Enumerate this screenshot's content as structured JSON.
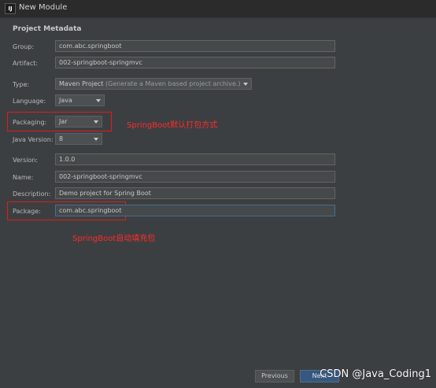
{
  "window": {
    "title": "New Module",
    "icon": "intellij-icon"
  },
  "section_title": "Project Metadata",
  "fields": {
    "group": {
      "label": "Group:",
      "value": "com.abc.springboot"
    },
    "artifact": {
      "label": "Artifact:",
      "value": "002-springboot-springmvc"
    },
    "type": {
      "label": "Type:",
      "value": "Maven Project",
      "hint": "(Generate a Maven based project archive.)"
    },
    "language": {
      "label": "Language:",
      "value": "Java"
    },
    "packaging": {
      "label": "Packaging:",
      "value": "Jar"
    },
    "java_version": {
      "label": "Java Version:",
      "value": "8"
    },
    "version": {
      "label": "Version:",
      "value": "1.0.0"
    },
    "name": {
      "label": "Name:",
      "value": "002-springboot-springmvc"
    },
    "description": {
      "label": "Description:",
      "value": "Demo project for Spring Boot"
    },
    "package": {
      "label": "Package:",
      "value": "com.abc.springboot"
    }
  },
  "annotations": {
    "packaging_note": "SpringBoot默认打包方式",
    "package_note": "SpringBoot自动填充包"
  },
  "buttons": {
    "previous": "Previous",
    "next": "Next"
  },
  "watermark": "CSDN @Java_Coding1",
  "colors": {
    "annotation_red": "#e21b1b",
    "primary_button": "#365880",
    "dialog_bg": "#3c3f41"
  }
}
